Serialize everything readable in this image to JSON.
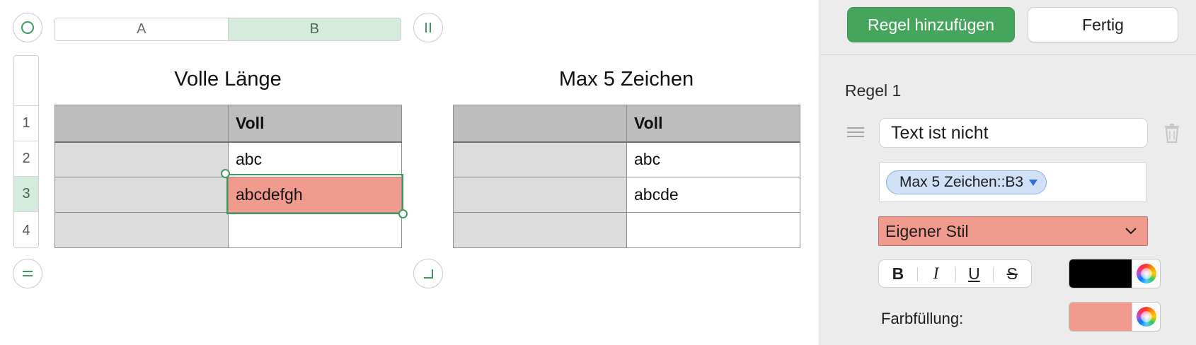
{
  "spreadsheet": {
    "column_headers": [
      "A",
      "B"
    ],
    "selected_column": "B",
    "row_headers": [
      "1",
      "2",
      "3",
      "4"
    ],
    "selected_row": "3",
    "tables": [
      {
        "title": "Volle Länge",
        "header": [
          "",
          "Voll"
        ],
        "rows": [
          [
            "",
            "abc"
          ],
          [
            "",
            "abcdefgh"
          ],
          [
            "",
            ""
          ]
        ]
      },
      {
        "title": "Max 5 Zeichen",
        "header": [
          "",
          "Voll"
        ],
        "rows": [
          [
            "",
            "abc"
          ],
          [
            "",
            "abcde"
          ],
          [
            "",
            ""
          ]
        ]
      }
    ],
    "highlight_color": "#f19b8f",
    "selection_color": "#3e9b5e"
  },
  "panel": {
    "add_rule_label": "Regel hinzufügen",
    "done_label": "Fertig",
    "rule_title": "Regel 1",
    "condition": "Text ist nicht",
    "reference_token": "Max 5 Zeichen::B3",
    "style_select": "Eigener Stil",
    "format_buttons": {
      "bold": "B",
      "italic": "I",
      "underline": "U",
      "strikethrough": "S"
    },
    "text_color": "#000000",
    "fill_label": "Farbfüllung:",
    "fill_color": "#f19b8f",
    "accent_color": "#45a55c"
  }
}
